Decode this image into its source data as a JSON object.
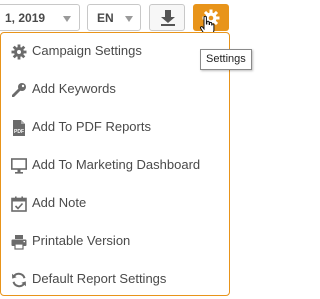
{
  "toolbar": {
    "date_value": "1, 2019",
    "language_value": "EN",
    "download_icon": "download-arrow-icon",
    "settings_icon": "gear-icon",
    "accent_color": "#e8941a"
  },
  "tooltip": {
    "text": "Settings"
  },
  "menu": {
    "items": [
      {
        "label": "Campaign Settings",
        "icon": "gear-icon"
      },
      {
        "label": "Add Keywords",
        "icon": "key-icon"
      },
      {
        "label": "Add To PDF Reports",
        "icon": "pdf-icon"
      },
      {
        "label": "Add To Marketing Dashboard",
        "icon": "monitor-icon"
      },
      {
        "label": "Add Note",
        "icon": "calendar-check-icon"
      },
      {
        "label": "Printable Version",
        "icon": "printer-icon"
      },
      {
        "label": "Default Report Settings",
        "icon": "refresh-icon"
      }
    ]
  }
}
